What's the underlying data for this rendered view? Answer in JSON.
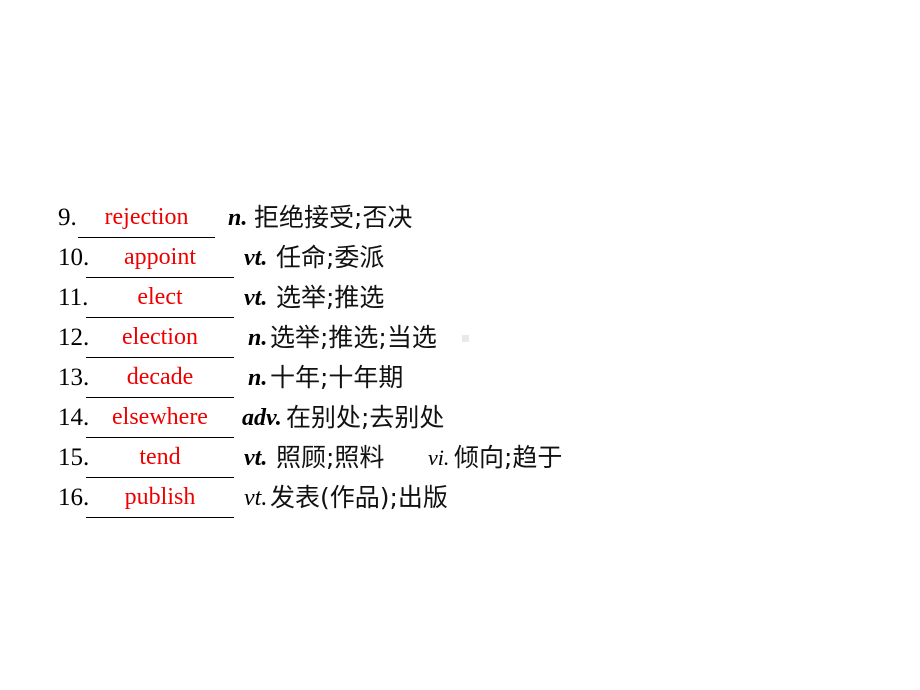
{
  "slide": {
    "background_color": "#ffffff",
    "answer_color": "#ee0000",
    "text_color": "#000000",
    "type": "vocabulary-fill-in-the-blank"
  },
  "entries": [
    {
      "number": "9.",
      "answer": "rejection",
      "pos": "n.",
      "pos_style": "italic",
      "gloss": "拒绝接受;否决",
      "pos2": "",
      "gloss2": ""
    },
    {
      "number": "10.",
      "answer": "appoint",
      "pos": "vt.",
      "pos_style": "bold-italic",
      "gloss": "任命;委派",
      "pos2": "",
      "gloss2": ""
    },
    {
      "number": "11.",
      "answer": "elect",
      "pos": "vt.",
      "pos_style": "bold-italic",
      "gloss": "选举;推选",
      "pos2": "",
      "gloss2": ""
    },
    {
      "number": "12.",
      "answer": "election",
      "pos": "n.",
      "pos_style": "bold-italic",
      "gloss": "选举;推选;当选",
      "pos2": "",
      "gloss2": ""
    },
    {
      "number": "13.",
      "answer": "decade",
      "pos": "n.",
      "pos_style": "italic",
      "gloss": "十年;十年期",
      "pos2": "",
      "gloss2": ""
    },
    {
      "number": "14.",
      "answer": "elsewhere",
      "pos": "adv.",
      "pos_style": "bold-italic",
      "gloss": "在别处;去别处",
      "pos2": "",
      "gloss2": ""
    },
    {
      "number": "15.",
      "answer": "tend",
      "pos": "vt.",
      "pos_style": "bold-italic",
      "gloss": "照顾;照料",
      "pos2": "vi.",
      "gloss2": "倾向;趋于"
    },
    {
      "number": "16.",
      "answer": "publish",
      "pos": "vt.",
      "pos_style": "italic",
      "gloss": "发表(作品);出版",
      "pos2": "",
      "gloss2": ""
    }
  ]
}
